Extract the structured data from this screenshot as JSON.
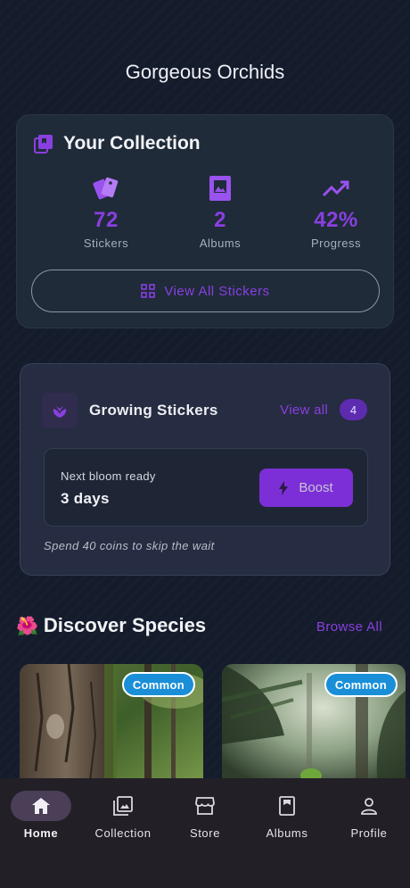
{
  "app": {
    "title": "Gorgeous Orchids"
  },
  "collection": {
    "title": "Your Collection",
    "stats": [
      {
        "value": "72",
        "label": "Stickers",
        "icon": "stickers-icon"
      },
      {
        "value": "2",
        "label": "Albums",
        "icon": "album-icon"
      },
      {
        "value": "42%",
        "label": "Progress",
        "icon": "trending-up-icon"
      }
    ],
    "view_all_label": "View All Stickers"
  },
  "growing": {
    "title": "Growing Stickers",
    "view_all": "View all",
    "count": "4",
    "bloom_label": "Next bloom ready",
    "bloom_value": "3 days",
    "boost_label": "Boost",
    "hint": "Spend 40 coins to skip the wait"
  },
  "discover": {
    "emoji": "🌺",
    "title": "Discover Species",
    "browse_all": "Browse All",
    "cards": [
      {
        "rarity": "Common"
      },
      {
        "rarity": "Common"
      }
    ]
  },
  "nav": {
    "items": [
      {
        "label": "Home",
        "icon": "home-icon",
        "active": true
      },
      {
        "label": "Collection",
        "icon": "collection-icon"
      },
      {
        "label": "Store",
        "icon": "store-icon"
      },
      {
        "label": "Albums",
        "icon": "albums-icon"
      },
      {
        "label": "Profile",
        "icon": "profile-icon"
      }
    ]
  },
  "colors": {
    "accent": "#8a3fe0",
    "background": "#141c2c",
    "card": "#1f2b39",
    "badge": "#1a8fd8"
  }
}
